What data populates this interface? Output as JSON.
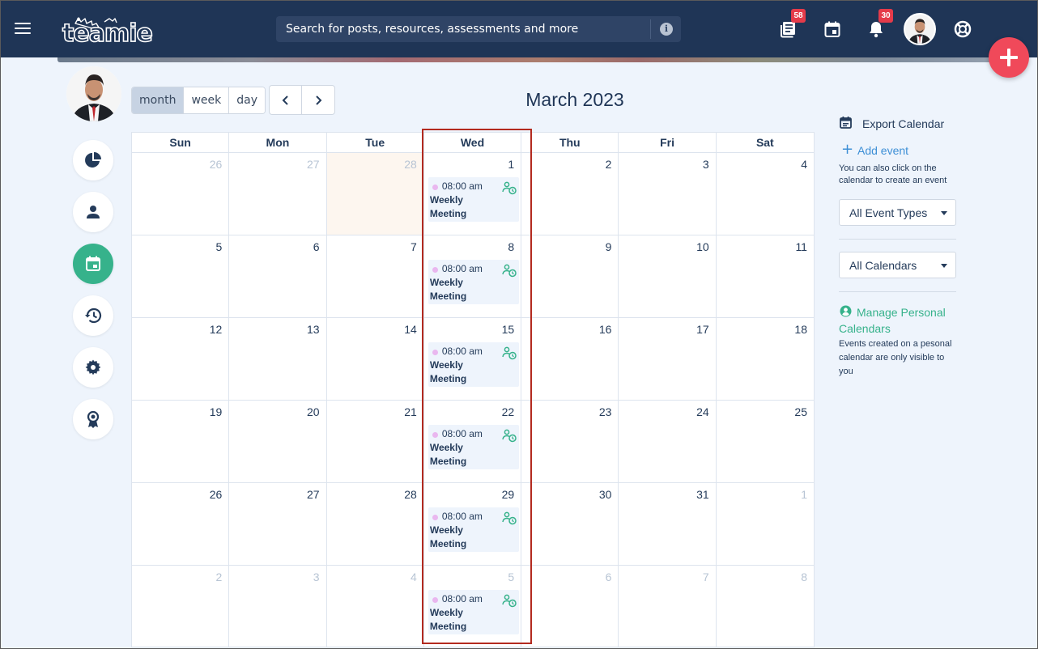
{
  "header": {
    "search_placeholder": "Search for posts, resources, assessments and more",
    "logo_text": "teamie",
    "posts_badge": "58",
    "notifications_badge": "30"
  },
  "toolbar": {
    "views": [
      {
        "label": "month",
        "active": true
      },
      {
        "label": "week",
        "active": false
      },
      {
        "label": "day",
        "active": false
      }
    ],
    "title": "March 2023"
  },
  "calendar": {
    "weekdays": [
      "Sun",
      "Mon",
      "Tue",
      "Wed",
      "Thu",
      "Fri",
      "Sat"
    ],
    "weeks": [
      [
        {
          "day": "26",
          "other": true
        },
        {
          "day": "27",
          "other": true
        },
        {
          "day": "28",
          "other": true,
          "today": true
        },
        {
          "day": "1",
          "event": true
        },
        {
          "day": "2"
        },
        {
          "day": "3"
        },
        {
          "day": "4"
        }
      ],
      [
        {
          "day": "5"
        },
        {
          "day": "6"
        },
        {
          "day": "7"
        },
        {
          "day": "8",
          "event": true
        },
        {
          "day": "9"
        },
        {
          "day": "10"
        },
        {
          "day": "11"
        }
      ],
      [
        {
          "day": "12"
        },
        {
          "day": "13"
        },
        {
          "day": "14"
        },
        {
          "day": "15",
          "event": true
        },
        {
          "day": "16"
        },
        {
          "day": "17"
        },
        {
          "day": "18"
        }
      ],
      [
        {
          "day": "19"
        },
        {
          "day": "20"
        },
        {
          "day": "21"
        },
        {
          "day": "22",
          "event": true
        },
        {
          "day": "23"
        },
        {
          "day": "24"
        },
        {
          "day": "25"
        }
      ],
      [
        {
          "day": "26"
        },
        {
          "day": "27"
        },
        {
          "day": "28"
        },
        {
          "day": "29",
          "event": true
        },
        {
          "day": "30"
        },
        {
          "day": "31"
        },
        {
          "day": "1",
          "other": true
        }
      ],
      [
        {
          "day": "2",
          "other": true
        },
        {
          "day": "3",
          "other": true
        },
        {
          "day": "4",
          "other": true
        },
        {
          "day": "5",
          "other": true,
          "event": true
        },
        {
          "day": "6",
          "other": true
        },
        {
          "day": "7",
          "other": true
        },
        {
          "day": "8",
          "other": true
        }
      ]
    ],
    "event": {
      "time": "08:00 am",
      "title": "Weekly Meeting",
      "dot_color": "#e9b7ef"
    }
  },
  "sidebar": {
    "export_label": "Export Calendar",
    "add_event_label": "Add event",
    "add_event_hint": "You can also click on the calendar to create an event",
    "event_types_label": "All Event Types",
    "calendars_label": "All Calendars",
    "manage_label": "Manage Personal Calendars",
    "manage_hint": "Events created on a pesonal calendar are only visible to you"
  },
  "left_rail": {
    "icons": [
      "pie-chart-icon",
      "person-icon",
      "calendar-icon",
      "history-icon",
      "gear-icon",
      "award-icon"
    ],
    "active": "calendar-icon"
  },
  "colors": {
    "topbar": "#1f3556",
    "accent_green": "#36b28b",
    "fab": "#f0495a",
    "badge": "#e53b4a",
    "highlight": "#b32a1f",
    "link_blue": "#3d8fd6"
  }
}
